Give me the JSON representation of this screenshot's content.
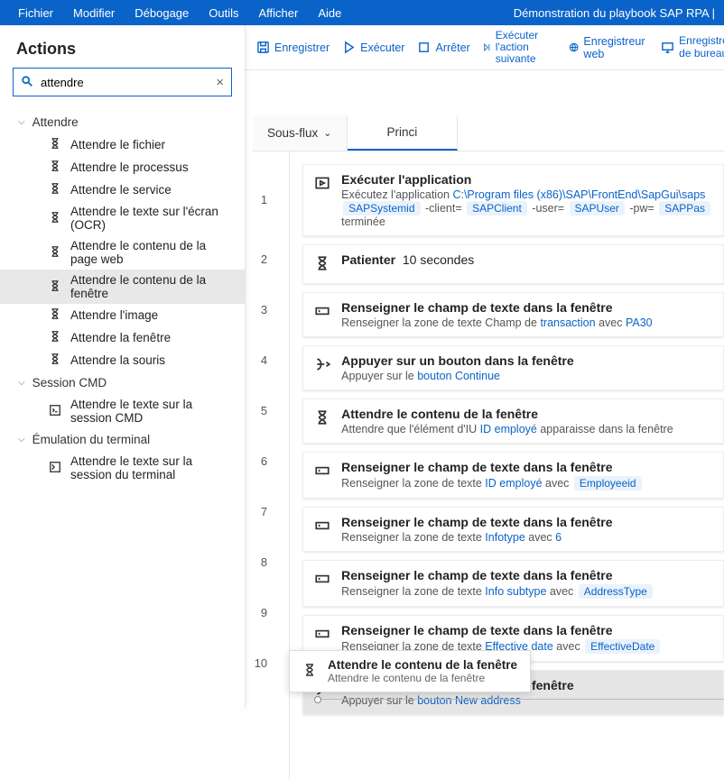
{
  "menu": {
    "items": [
      "Fichier",
      "Modifier",
      "Débogage",
      "Outils",
      "Afficher",
      "Aide"
    ],
    "title_right": "Démonstration du playbook SAP RPA | "
  },
  "toolbar": {
    "save": "Enregistrer",
    "run": "Exécuter",
    "stop": "Arrêter",
    "run_next_l1": "Exécuter l'action",
    "run_next_l2": "suivante",
    "web_recorder": "Enregistreur web",
    "desktop_rec_l1": "Enregistrement",
    "desktop_rec_l2": "de bureau"
  },
  "sidebar": {
    "header": "Actions",
    "search_value": "attendre",
    "groups": [
      {
        "label": "Attendre",
        "items": [
          "Attendre le fichier",
          "Attendre le processus",
          "Attendre le service",
          "Attendre le texte sur l'écran (OCR)",
          "Attendre le contenu de la page web",
          "Attendre le contenu de la fenêtre",
          "Attendre l'image",
          "Attendre la fenêtre",
          "Attendre la souris"
        ],
        "selected_index": 5
      },
      {
        "label": "Session CMD",
        "icon": "cmd",
        "items": [
          "Attendre le texte sur la session CMD"
        ]
      },
      {
        "label": "Émulation du terminal",
        "icon": "terminal",
        "items": [
          "Attendre le texte sur la session du terminal"
        ]
      }
    ]
  },
  "tabs": {
    "subflows": "Sous-flux",
    "main": "Princi"
  },
  "steps": [
    {
      "num": "1",
      "icon": "play-window",
      "title": "Exécuter l'application",
      "runs": [
        {
          "t": "Exécutez l'application "
        },
        {
          "t": "C:\\Program files (x86)\\SAP\\FrontEnd\\SapGui\\saps",
          "cls": "link"
        }
      ],
      "runs2": [
        {
          "t": "SAPSystemid",
          "cls": "pill"
        },
        {
          "t": " -client= "
        },
        {
          "t": "SAPClient",
          "cls": "pill"
        },
        {
          "t": " -user= "
        },
        {
          "t": "SAPUser",
          "cls": "pill"
        },
        {
          "t": " -pw= "
        },
        {
          "t": "SAPPas",
          "cls": "pill"
        }
      ],
      "runs3": [
        {
          "t": "terminée"
        }
      ]
    },
    {
      "num": "2",
      "icon": "hourglass",
      "title": "Patienter",
      "runs": [
        {
          "t": "10",
          "cls": "link"
        },
        {
          "t": " secondes"
        }
      ],
      "title_inline": true
    },
    {
      "num": "3",
      "icon": "textbox",
      "title": "Renseigner le champ de texte dans la fenêtre",
      "runs": [
        {
          "t": "Renseigner la zone de texte Champ de "
        },
        {
          "t": "transaction",
          "cls": "link"
        },
        {
          "t": " avec "
        },
        {
          "t": "PA30",
          "cls": "link"
        }
      ]
    },
    {
      "num": "4",
      "icon": "cursor",
      "title": "Appuyer sur un bouton dans la fenêtre",
      "runs": [
        {
          "t": "Appuyer sur le "
        },
        {
          "t": "bouton Continue",
          "cls": "link"
        }
      ]
    },
    {
      "num": "5",
      "icon": "hourglass",
      "title": "Attendre le contenu de la fenêtre",
      "runs": [
        {
          "t": "Attendre que l'élément d'IU "
        },
        {
          "t": "ID employé",
          "cls": "link"
        },
        {
          "t": " apparaisse dans la fenêtre"
        }
      ]
    },
    {
      "num": "6",
      "icon": "textbox",
      "title": "Renseigner le champ de texte dans la fenêtre",
      "runs": [
        {
          "t": "Renseigner la zone de texte "
        },
        {
          "t": "ID employé",
          "cls": "link"
        },
        {
          "t": " avec "
        },
        {
          "t": "Employeeid",
          "cls": "pill"
        }
      ]
    },
    {
      "num": "7",
      "icon": "textbox",
      "title": "Renseigner le champ de texte dans la fenêtre",
      "runs": [
        {
          "t": "Renseigner la zone de texte "
        },
        {
          "t": "Infotype",
          "cls": "link"
        },
        {
          "t": " avec "
        },
        {
          "t": "6",
          "cls": "link"
        }
      ]
    },
    {
      "num": "8",
      "icon": "textbox",
      "title": "Renseigner le champ de texte dans la fenêtre",
      "runs": [
        {
          "t": "Renseigner la zone de texte "
        },
        {
          "t": "Info subtype",
          "cls": "link"
        },
        {
          "t": " avec "
        },
        {
          "t": "AddressType",
          "cls": "pill"
        }
      ]
    },
    {
      "num": "9",
      "icon": "textbox",
      "title": "Renseigner le champ de texte dans la fenêtre",
      "runs": [
        {
          "t": "Renseigner la zone de texte "
        },
        {
          "t": "Effective date",
          "cls": "link"
        },
        {
          "t": " avec "
        },
        {
          "t": "EffectiveDate",
          "cls": "pill"
        }
      ]
    },
    {
      "num": "10",
      "icon": "cursor",
      "selected": true,
      "title": "Appuyer sur un bouton dans la fenêtre",
      "runs": [
        {
          "t": "Appuyer sur le "
        },
        {
          "t": "bouton New address",
          "cls": "link"
        }
      ]
    }
  ],
  "hint": {
    "title": "Attendre le contenu de la fenêtre",
    "sub": "Attendre le contenu de la fenêtre"
  }
}
